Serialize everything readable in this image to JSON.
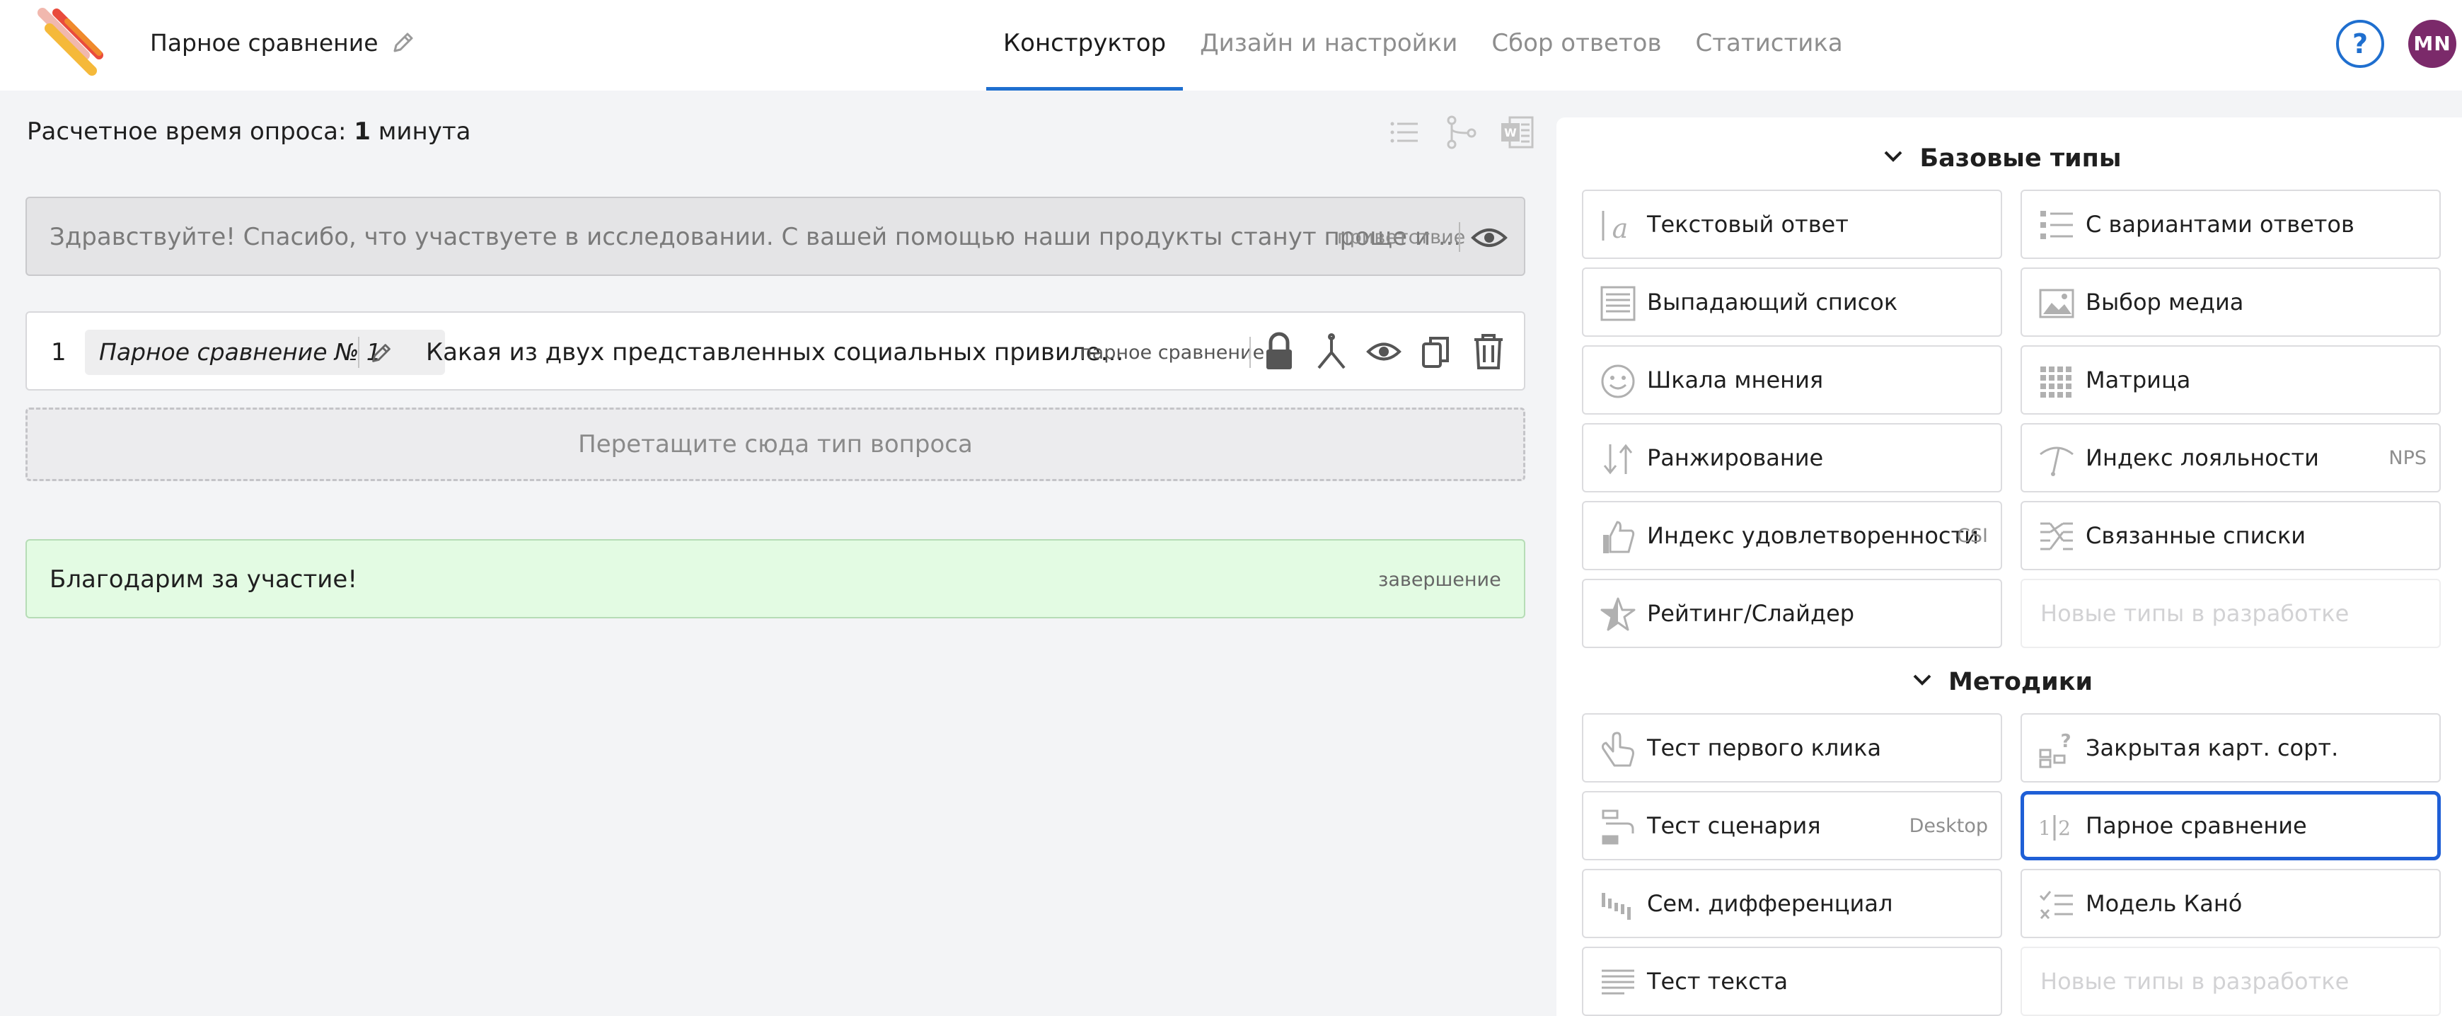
{
  "header": {
    "survey_title": "Парное сравнение",
    "tabs": [
      {
        "label": "Конструктор",
        "active": true
      },
      {
        "label": "Дизайн и настройки",
        "active": false
      },
      {
        "label": "Сбор ответов",
        "active": false
      },
      {
        "label": "Статистика",
        "active": false
      }
    ],
    "help_label": "?",
    "avatar_initials": "MN"
  },
  "left": {
    "estimated_time_prefix": "Расчетное время опроса:",
    "estimated_time_value": "1",
    "estimated_time_unit": "минута",
    "welcome": {
      "text": "Здравствуйте! Спасибо, что участвуете в исследовании. С вашей помощью наши продукты станут проще и ...",
      "tag": "приветствие"
    },
    "question": {
      "number": "1",
      "name": "Парное сравнение № 1",
      "text": "Какая из двух представленных социальных привиле...",
      "type": "парное сравнение"
    },
    "dropzone_text": "Перетащите сюда тип вопроса",
    "finish": {
      "text": "Благодарим за участие!",
      "tag": "завершение"
    }
  },
  "right": {
    "basic_title": "Базовые типы",
    "basic_items": [
      {
        "label": "Текстовый ответ",
        "badge": "",
        "icon": "text-answer-icon"
      },
      {
        "label": "С вариантами ответов",
        "badge": "",
        "icon": "choice-list-icon"
      },
      {
        "label": "Выпадающий список",
        "badge": "",
        "icon": "dropdown-list-icon"
      },
      {
        "label": "Выбор медиа",
        "badge": "",
        "icon": "media-image-icon"
      },
      {
        "label": "Шкала мнения",
        "badge": "",
        "icon": "smiley-icon"
      },
      {
        "label": "Матрица",
        "badge": "",
        "icon": "matrix-grid-icon"
      },
      {
        "label": "Ранжирование",
        "badge": "",
        "icon": "ranking-arrows-icon"
      },
      {
        "label": "Индекс лояльности",
        "badge": "NPS",
        "icon": "gauge-icon"
      },
      {
        "label": "Индекс удовлетворенности",
        "badge": "CSI",
        "icon": "thumbs-up-icon"
      },
      {
        "label": "Связанные списки",
        "badge": "",
        "icon": "linked-lists-icon"
      },
      {
        "label": "Рейтинг/Слайдер",
        "badge": "",
        "icon": "star-icon"
      },
      {
        "label": "Новые типы в разработке",
        "badge": "",
        "icon": ""
      }
    ],
    "methods_title": "Методики",
    "method_items": [
      {
        "label": "Тест первого клика",
        "badge": "",
        "icon": "hand-pointer-icon"
      },
      {
        "label": "Закрытая карт. сорт.",
        "badge": "",
        "icon": "card-sort-icon"
      },
      {
        "label": "Тест сценария",
        "badge": "Desktop",
        "icon": "scenario-icon"
      },
      {
        "label": "Парное сравнение",
        "badge": "",
        "icon": "pair-compare-icon",
        "icon_text": "1|2"
      },
      {
        "label": "Сем. дифференциал",
        "badge": "",
        "icon": "semantic-diff-icon"
      },
      {
        "label": "Модель Кано́",
        "badge": "",
        "icon": "kano-model-icon"
      },
      {
        "label": "Тест текста",
        "badge": "",
        "icon": "text-test-icon"
      },
      {
        "label": "Новые типы в разработке",
        "badge": "",
        "icon": ""
      }
    ]
  }
}
